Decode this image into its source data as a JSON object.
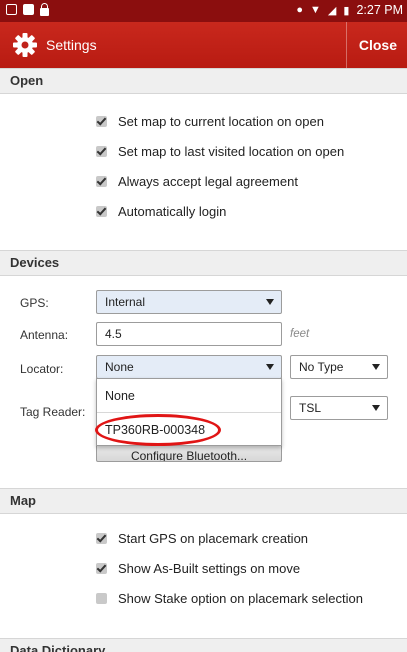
{
  "status_bar": {
    "time": "2:27 PM"
  },
  "app_bar": {
    "title": "Settings",
    "close_label": "Close"
  },
  "open_section": {
    "header": "Open",
    "options": [
      {
        "label": "Set map to current location on open",
        "checked": true
      },
      {
        "label": "Set map to last visited location on open",
        "checked": true
      },
      {
        "label": "Always accept legal agreement",
        "checked": true
      },
      {
        "label": "Automatically login",
        "checked": true
      }
    ]
  },
  "devices_section": {
    "header": "Devices",
    "gps": {
      "label": "GPS:",
      "value": "Internal"
    },
    "antenna": {
      "label": "Antenna:",
      "value": "4.5",
      "unit": "feet"
    },
    "locator": {
      "label": "Locator:",
      "value": "None",
      "type_value": "No Type",
      "dropdown_options": [
        "None",
        "TP360RB-000348"
      ]
    },
    "tag_reader": {
      "label": "Tag Reader:",
      "type_value": "TSL"
    },
    "configure_label": "Configure Bluetooth..."
  },
  "map_section": {
    "header": "Map",
    "options": [
      {
        "label": "Start GPS on placemark creation",
        "checked": true
      },
      {
        "label": "Show As-Built settings on move",
        "checked": true
      },
      {
        "label": "Show Stake option on placemark selection",
        "checked": false
      }
    ]
  },
  "data_dictionary_section": {
    "header": "Data Dictionary"
  },
  "colors": {
    "status_bar": "#8b0e0e",
    "app_bar": "#c9281d",
    "highlight": "#e01515",
    "selected_field": "#e4ecf7"
  }
}
